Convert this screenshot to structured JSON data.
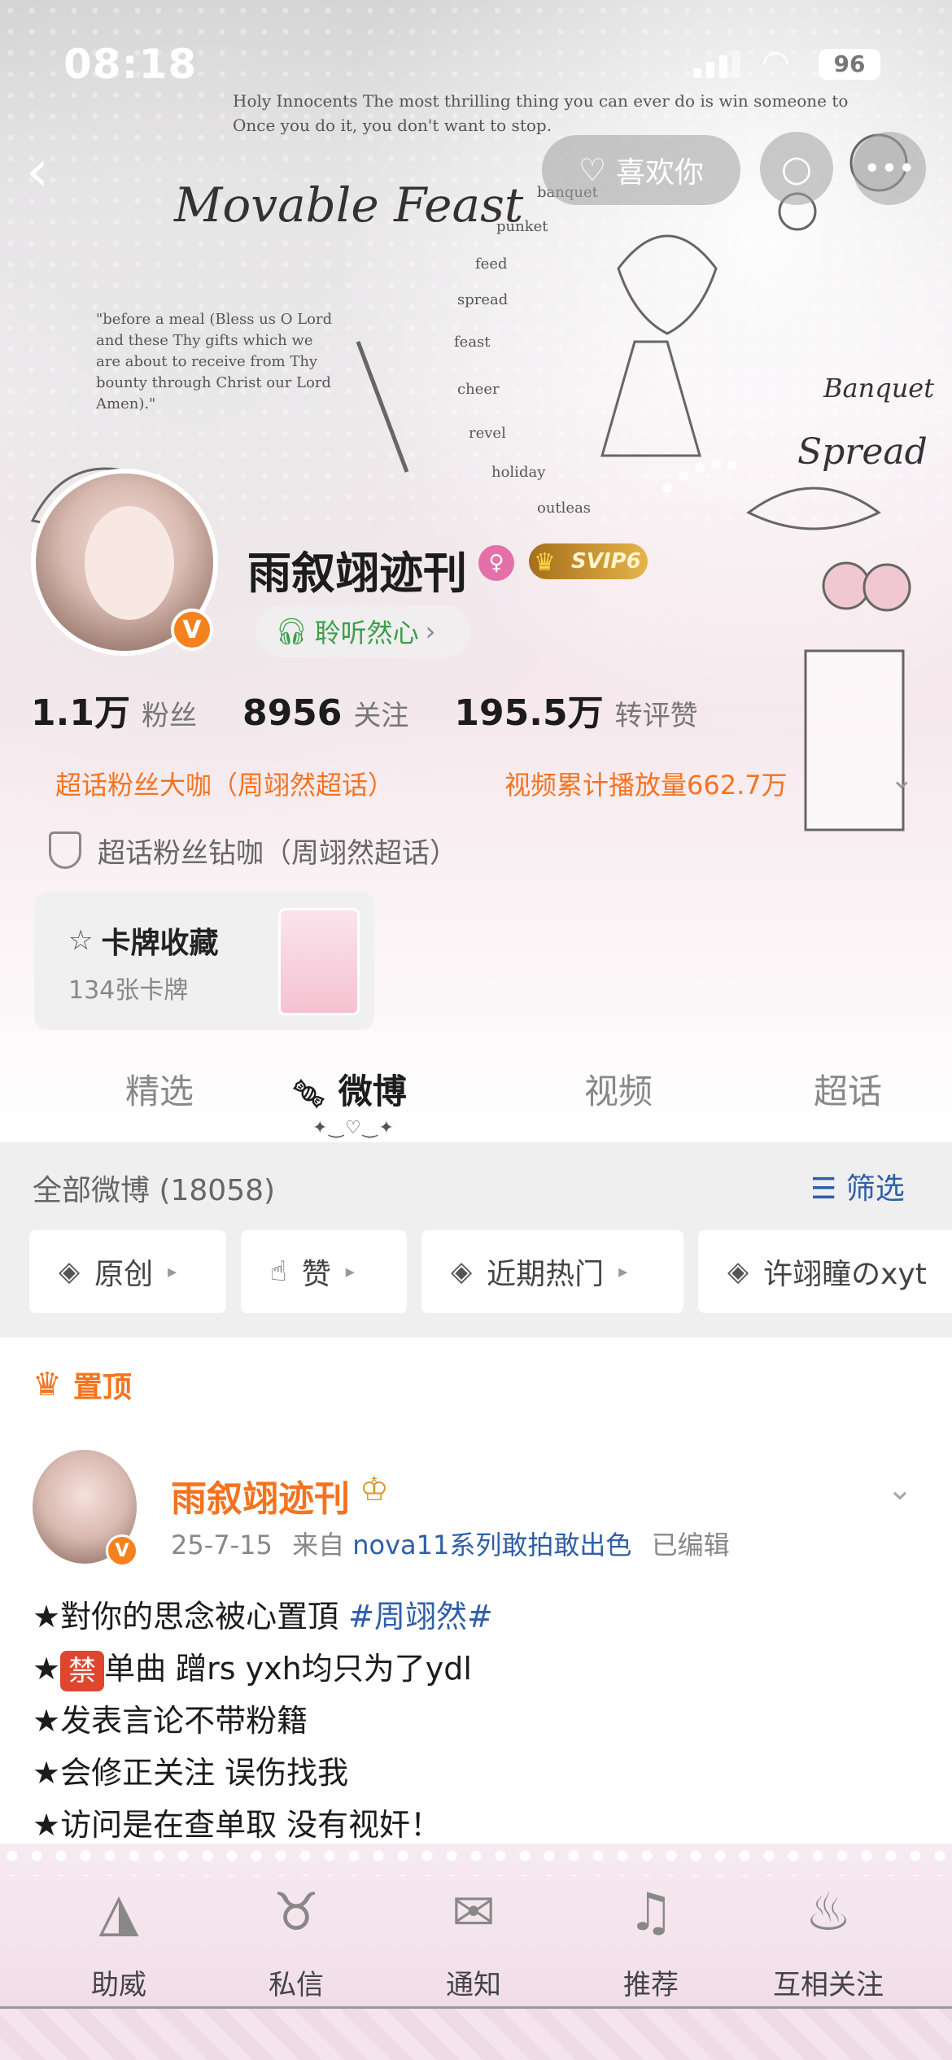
{
  "status_bar": {
    "time": "08:18",
    "battery": "96"
  },
  "banner": {
    "poem_line1": "Holy Innocents The most thrilling thing you can ever do is win someone to Christ.",
    "poem_line2": "Once you do it, you don't want to stop.",
    "title": "Movable Feast",
    "words": [
      "banquet",
      "punket",
      "feed",
      "spread",
      "feast",
      "cheer",
      "revel",
      "holiday",
      "outleas"
    ],
    "quote": "\"before a meal (Bless us O Lord and these Thy gifts which we are about to receive from Thy bounty through Christ our Lord Amen).\"",
    "script_1": "Banquet",
    "script_2": "Spread"
  },
  "header": {
    "like_label": "喜欢你",
    "search_icon": "search-icon",
    "more_icon": "more-icon"
  },
  "profile": {
    "username": "雨叙翊迹刊",
    "gender_symbol": "♀",
    "vip_label": "SVIP6",
    "verified_symbol": "V",
    "listen_label": "聆听然心",
    "stats": [
      {
        "num": "1.1万",
        "label": "粉丝"
      },
      {
        "num": "8956",
        "label": "关注"
      },
      {
        "num": "195.5万",
        "label": "转评赞"
      }
    ],
    "honor_1": "超话粉丝大咖（周翊然超话）",
    "honor_2": "视频累计播放量662.7万",
    "diamond": "超话粉丝钻咖（周翊然超话）"
  },
  "card_collection": {
    "title": "卡牌收藏",
    "subtitle": "134张卡牌"
  },
  "tabs": [
    {
      "label": "精选",
      "active": false
    },
    {
      "label": "微博",
      "active": true
    },
    {
      "label": "视频",
      "active": false
    },
    {
      "label": "超话",
      "active": false
    }
  ],
  "feed": {
    "all_posts": "全部微博 (18058)",
    "filter_label": "筛选",
    "chips": [
      "原创",
      "赞",
      "近期热门",
      "许翊瞳のxyt"
    ]
  },
  "pinned_post": {
    "pin_label": "置顶",
    "author": "雨叙翊迹刊",
    "date": "25-7-15",
    "from_prefix": "来自",
    "source": "nova11系列敢拍敢出色",
    "edited": "已编辑",
    "line1_text": "★對你的思念被心置頂 ",
    "line1_tag": "#周翊然#",
    "line2_star": "★",
    "line2_ban": "禁",
    "line2_text": "单曲 蹭rs yxh均只为了ydl",
    "line3": "★发表言论不带粉籍",
    "line4": "★会修正关注 误伤找我",
    "line5": "★访问是在查单取 没有视奸！"
  },
  "bottom_nav": [
    {
      "label": "助威",
      "icon": "cake-icon"
    },
    {
      "label": "私信",
      "icon": "goblet-icon"
    },
    {
      "label": "通知",
      "icon": "letter-icon"
    },
    {
      "label": "推荐",
      "icon": "lyre-icon"
    },
    {
      "label": "互相关注",
      "icon": "cupcake-icon"
    }
  ]
}
